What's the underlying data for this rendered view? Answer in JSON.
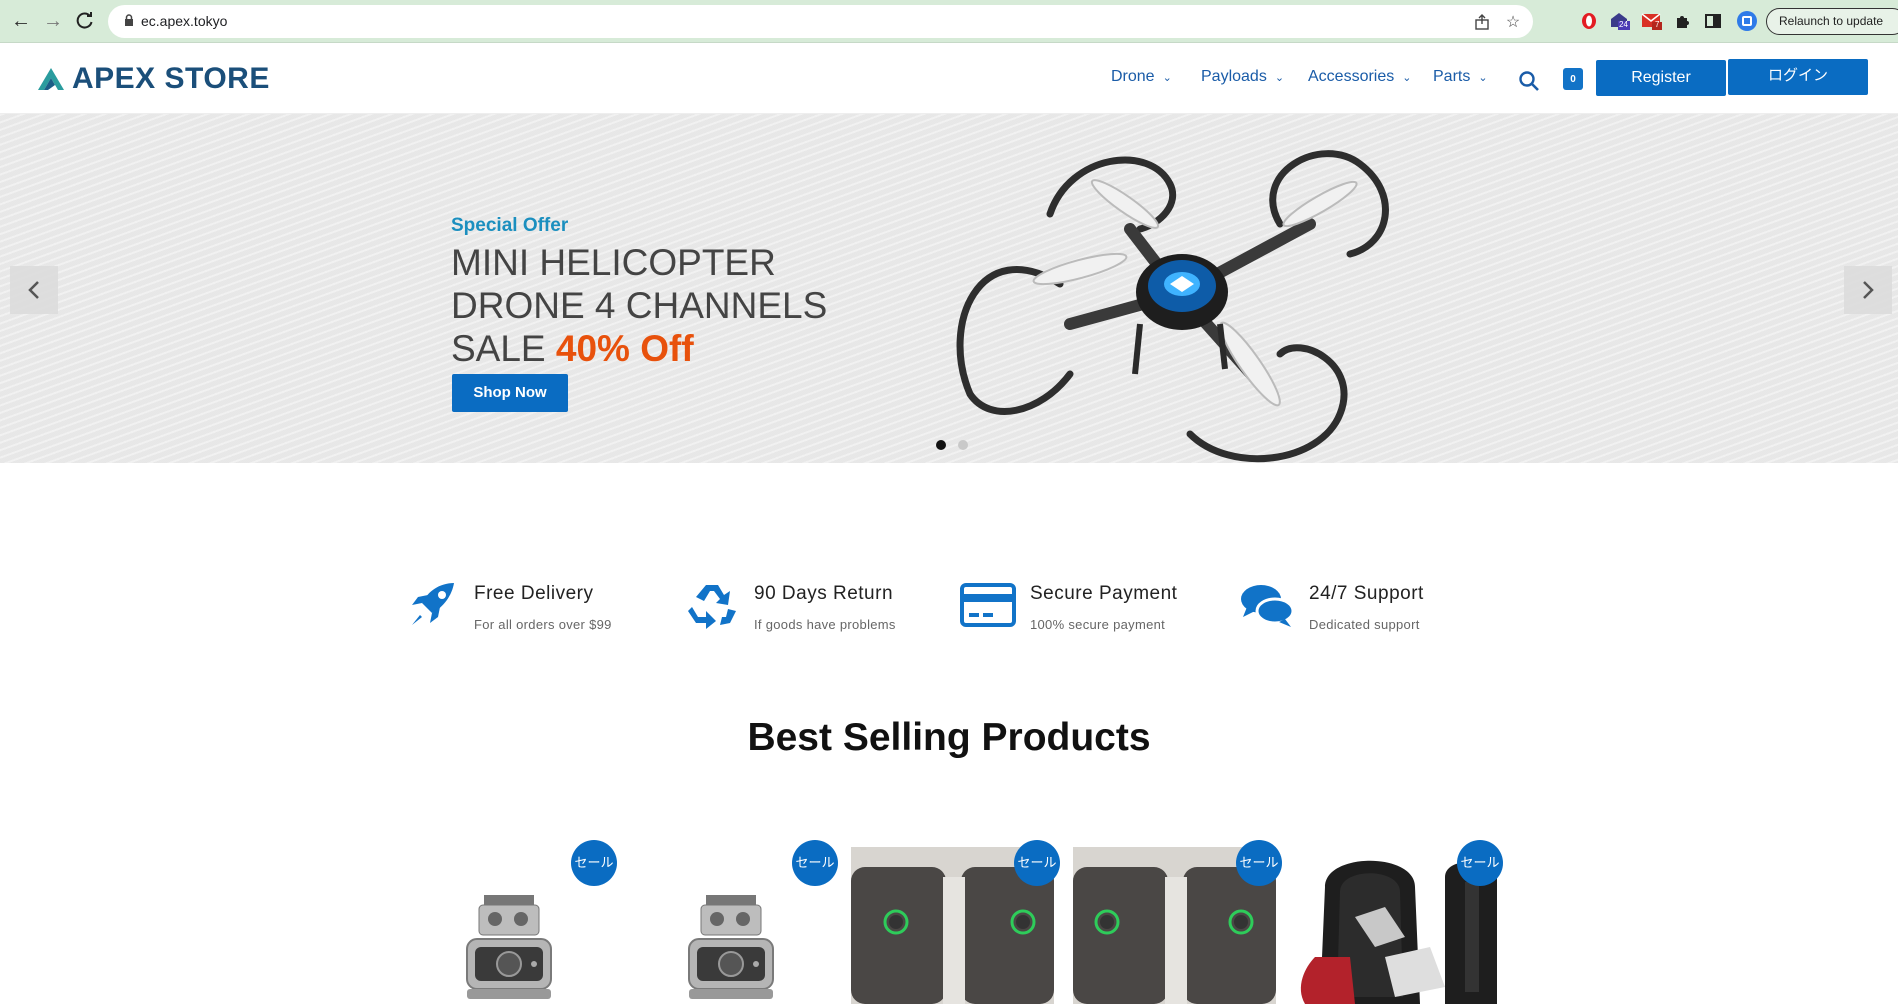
{
  "browser": {
    "url": "ec.apex.tokyo",
    "relaunch_label": "Relaunch to update",
    "ext_badge_1": "24",
    "ext_badge_2": "7"
  },
  "header": {
    "logo_text": "APEX STORE",
    "menu": [
      {
        "label": "Drone"
      },
      {
        "label": "Payloads"
      },
      {
        "label": "Accessories"
      },
      {
        "label": "Parts"
      }
    ],
    "cart_count": "0",
    "register_label": "Register",
    "login_label": "ログイン"
  },
  "hero": {
    "eyebrow": "Special Offer",
    "line1": "MINI HELICOPTER",
    "line2": "DRONE 4 CHANNELS",
    "line3_prefix": "SALE ",
    "line3_highlight": "40% Off",
    "cta": "Shop Now",
    "slides": 2,
    "active_slide": 1
  },
  "features": [
    {
      "title": "Free Delivery",
      "subtitle": "For all orders over $99",
      "icon": "rocket-icon"
    },
    {
      "title": "90 Days Return",
      "subtitle": "If goods have problems",
      "icon": "recycle-icon"
    },
    {
      "title": "Secure Payment",
      "subtitle": "100% secure payment",
      "icon": "credit-card-icon"
    },
    {
      "title": "24/7 Support",
      "subtitle": "Dedicated support",
      "icon": "chat-icon"
    }
  ],
  "best_selling": {
    "title": "Best Selling Products",
    "sale_label": "セール",
    "products": [
      {
        "type": "gimbal-camera"
      },
      {
        "type": "gimbal-camera"
      },
      {
        "type": "battery"
      },
      {
        "type": "battery"
      },
      {
        "type": "backpack"
      }
    ]
  },
  "colors": {
    "brand_blue": "#0a6cc2",
    "accent_orange": "#e8510c",
    "chrome_green": "#d7ebd8"
  }
}
